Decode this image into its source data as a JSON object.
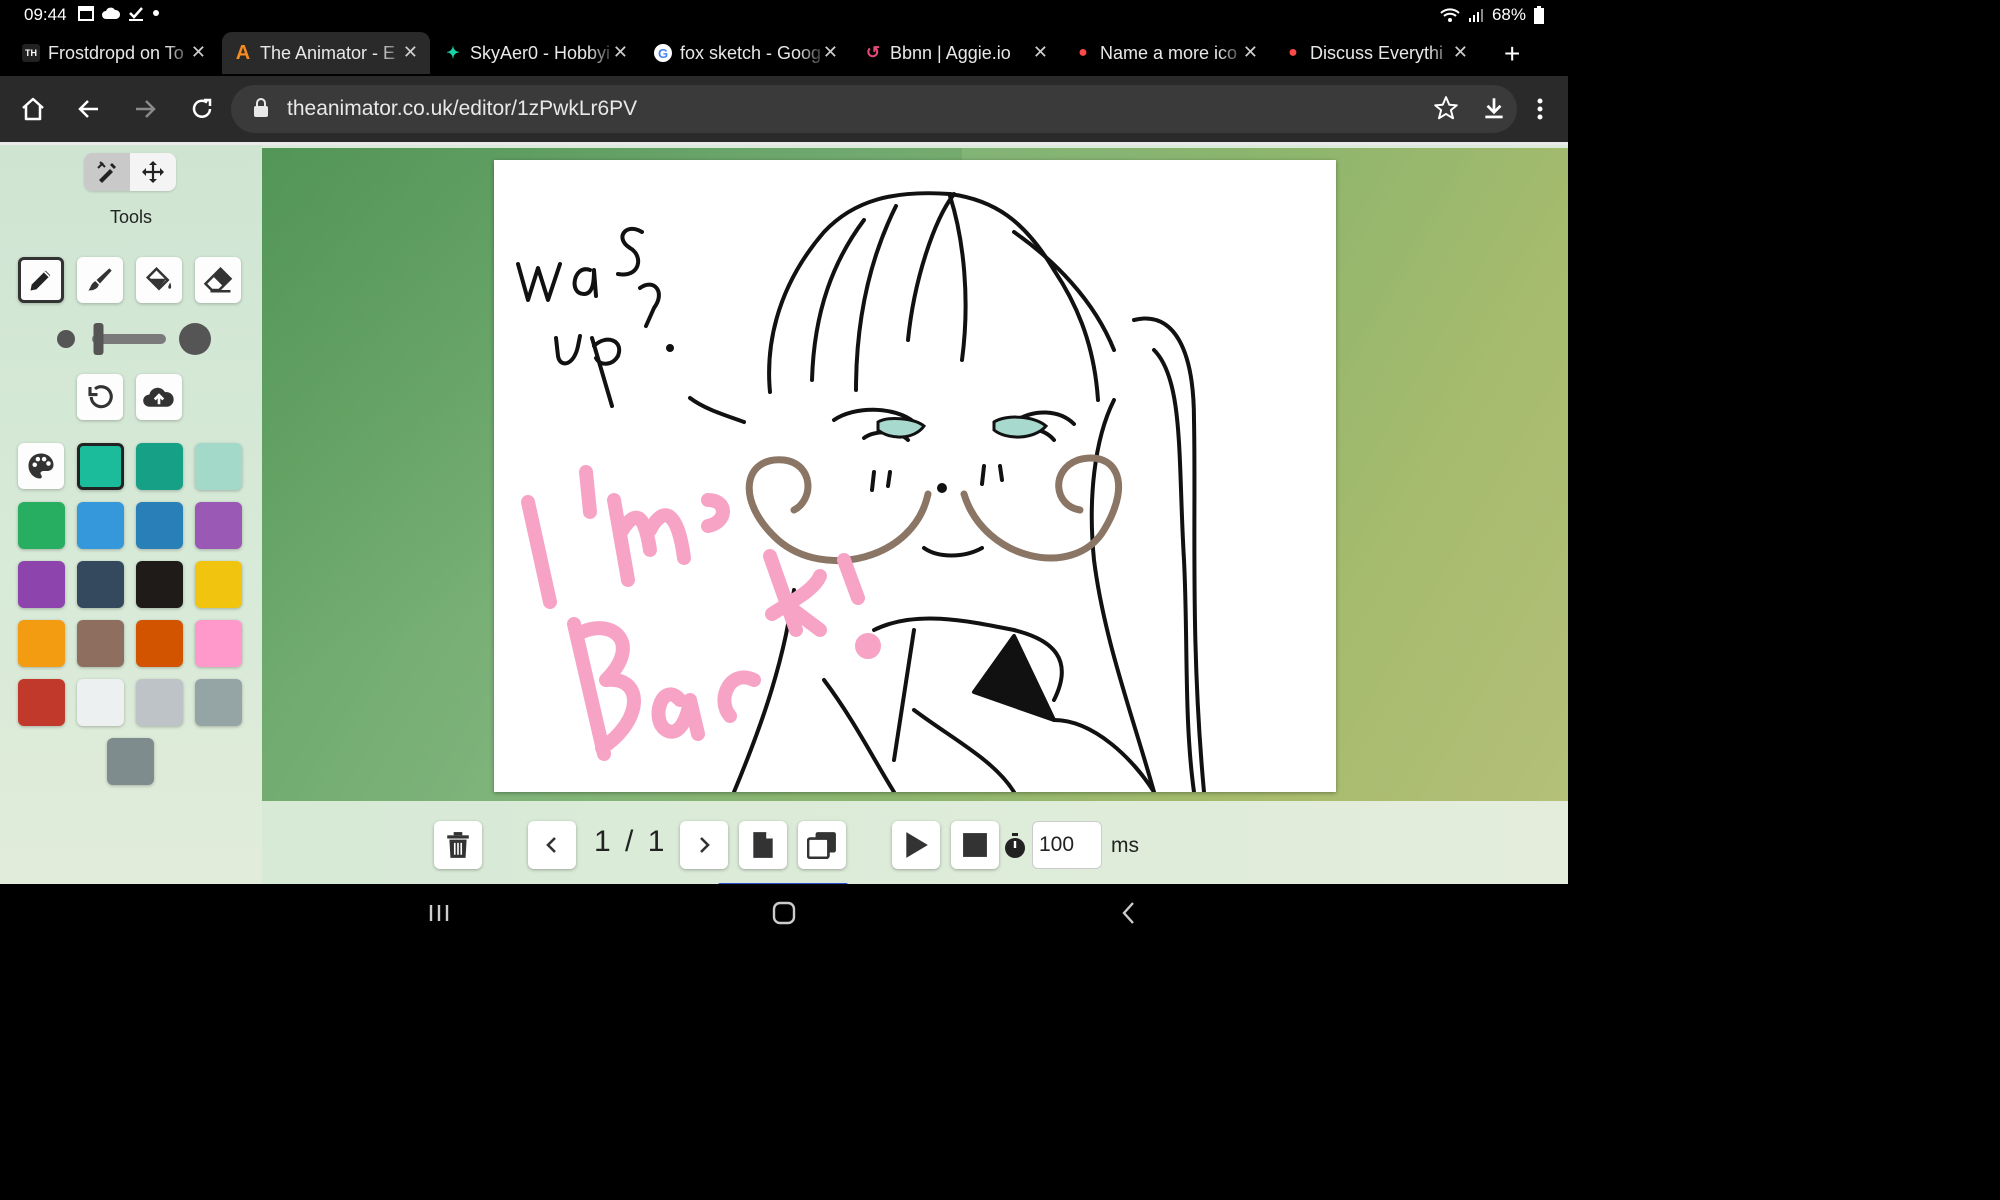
{
  "status_bar": {
    "time": "09:44",
    "battery": "68%"
  },
  "tabs": [
    {
      "title": "Frostdropd on To",
      "favicon": "TH",
      "favicon_color": "#ffffff",
      "active": false
    },
    {
      "title": "The Animator - E",
      "favicon": "A",
      "favicon_color": "#f58a1f",
      "active": true
    },
    {
      "title": "SkyAer0 - Hobbyi",
      "favicon": "✦",
      "favicon_color": "#19d3a7",
      "active": false
    },
    {
      "title": "fox sketch - Goog",
      "favicon": "G",
      "favicon_color": "#4285f4",
      "active": false
    },
    {
      "title": "Bbnn | Aggie.io",
      "favicon": "↺",
      "favicon_color": "#e64b78",
      "active": false
    },
    {
      "title": "Name a more ico",
      "favicon": "●",
      "favicon_color": "#ff4a4a",
      "active": false
    },
    {
      "title": "Discuss Everythi",
      "favicon": "●",
      "favicon_color": "#ff4a4a",
      "active": false
    }
  ],
  "address_bar": {
    "url": "theanimator.co.uk/editor/1zPwkLr6PV"
  },
  "sidebar": {
    "tools_label": "Tools",
    "palette": [
      "#1abc9c",
      "#16a085",
      "#a3d9c9",
      "#27ae60",
      "#3498db",
      "#2980b9",
      "#9b59b6",
      "#8e44ad",
      "#34495e",
      "#1e1b18",
      "#f1c40f",
      "#f39c12",
      "#8d6e5f",
      "#d35400",
      "#ff99cc",
      "#c0392b",
      "#ecf0f1",
      "#bdc3c7",
      "#95a5a6"
    ],
    "selected_color": "#1abc9c",
    "current_color": "#7f8c8d",
    "brush_size_fraction": 0.05
  },
  "canvas": {
    "text_was_up": "was up?",
    "text_im_back": "I'm Back!",
    "colors": {
      "ink": "#111111",
      "pink": "#f7a3c6",
      "brown": "#8b7565",
      "eyes": "#a8d9cf"
    }
  },
  "timeline": {
    "current_frame": "1",
    "separator": "/",
    "total_frames": "1",
    "frame_delay": "100",
    "delay_unit": "ms"
  }
}
